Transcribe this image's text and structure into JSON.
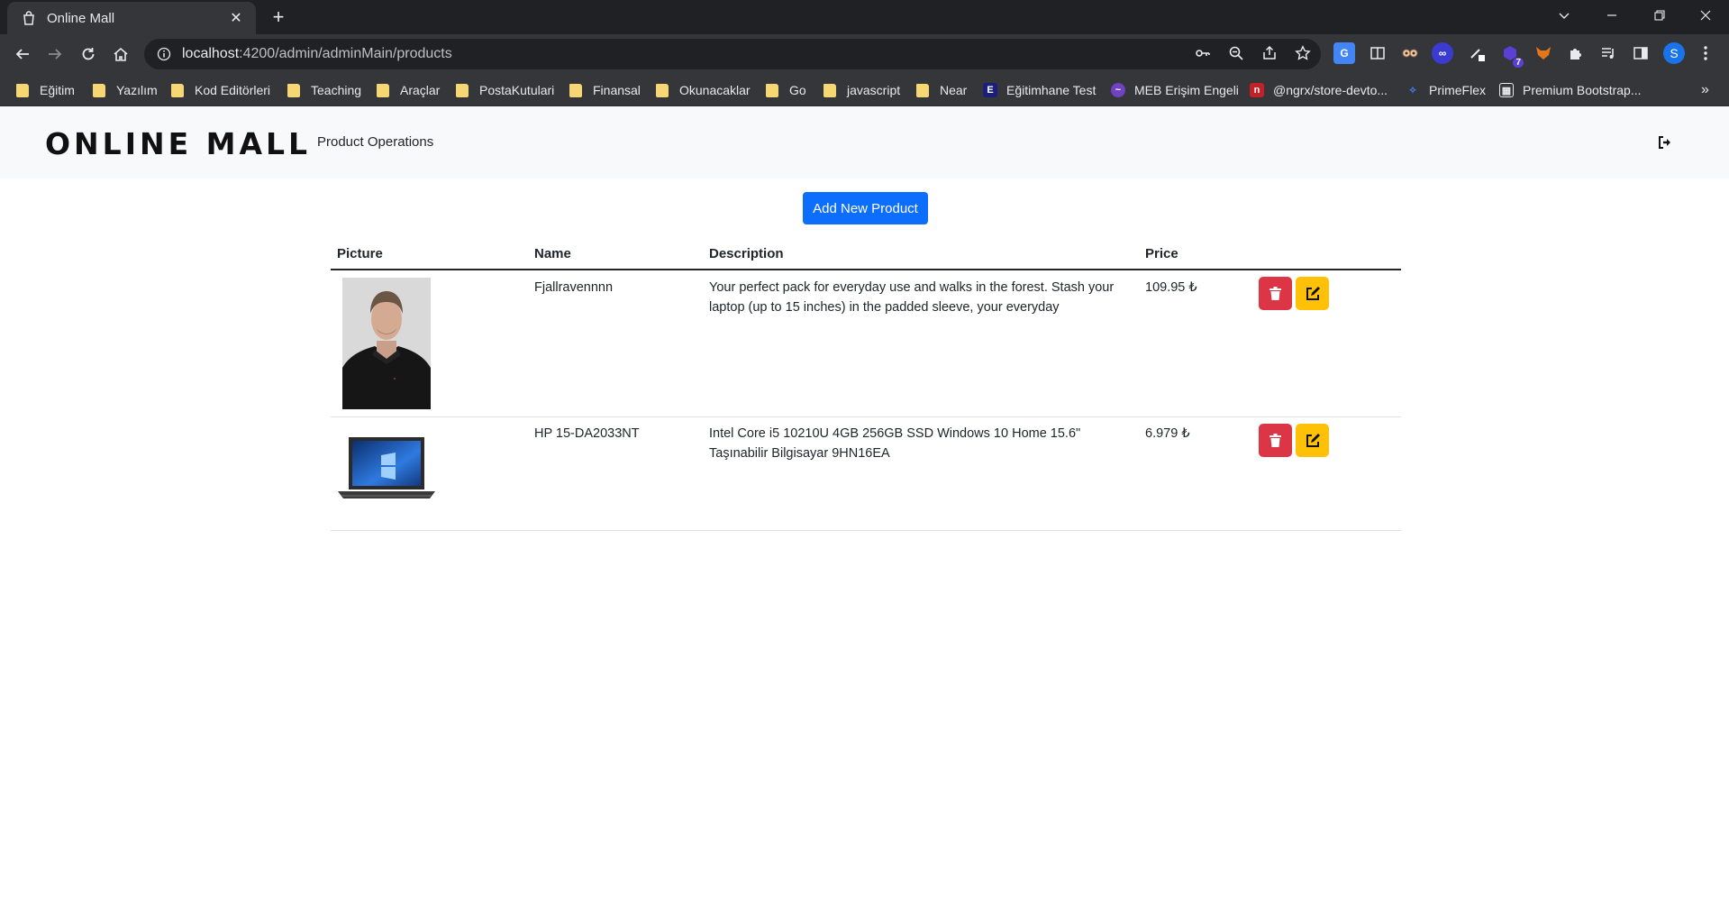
{
  "browser": {
    "tab_title": "Online Mall",
    "tab_close": "✕",
    "new_tab": "+",
    "url_host": "localhost",
    "url_path": ":4200/admin/adminMain/products",
    "profile_initial": "S",
    "extension_badge": "7",
    "bookmarks": [
      {
        "label": "Eğitim",
        "type": "folder"
      },
      {
        "label": "Yazılım",
        "type": "folder"
      },
      {
        "label": "Kod Editörleri",
        "type": "folder"
      },
      {
        "label": "Teaching",
        "type": "folder"
      },
      {
        "label": "Araçlar",
        "type": "folder"
      },
      {
        "label": "PostaKutulari",
        "type": "folder"
      },
      {
        "label": "Finansal",
        "type": "folder"
      },
      {
        "label": "Okunacaklar",
        "type": "folder"
      },
      {
        "label": "Go",
        "type": "folder"
      },
      {
        "label": "javascript",
        "type": "folder"
      },
      {
        "label": "Near",
        "type": "folder"
      },
      {
        "label": "Eğitimhane Test",
        "type": "site",
        "icon": "E"
      },
      {
        "label": "MEB Erişim Engeli",
        "type": "site"
      },
      {
        "label": "@ngrx/store-devto...",
        "type": "site"
      },
      {
        "label": "PrimeFlex",
        "type": "site"
      },
      {
        "label": "Premium Bootstrap...",
        "type": "site"
      }
    ],
    "bookmarks_overflow": "»"
  },
  "app": {
    "brand": "ONLINE MALL",
    "nav_link": "Product Operations",
    "add_button": "Add New Product"
  },
  "table": {
    "headers": [
      "Picture",
      "Name",
      "Description",
      "Price"
    ],
    "rows": [
      {
        "picture": "man-in-black-sweater",
        "name": "Fjallravennnn",
        "description": "Your perfect pack for everyday use and walks in the forest. Stash your laptop (up to 15 inches) in the padded sleeve, your everyday",
        "price": "109.95 ₺"
      },
      {
        "picture": "black-laptop",
        "name": "HP 15-DA2033NT",
        "description": "Intel Core i5 10210U 4GB 256GB SSD Windows 10 Home 15.6\" Taşınabilir Bilgisayar 9HN16EA",
        "price": "6.979 ₺"
      }
    ]
  },
  "colors": {
    "primary": "#0d6efd",
    "danger": "#dc3545",
    "warning": "#ffc107",
    "navbar_bg": "#f8f9fa"
  }
}
